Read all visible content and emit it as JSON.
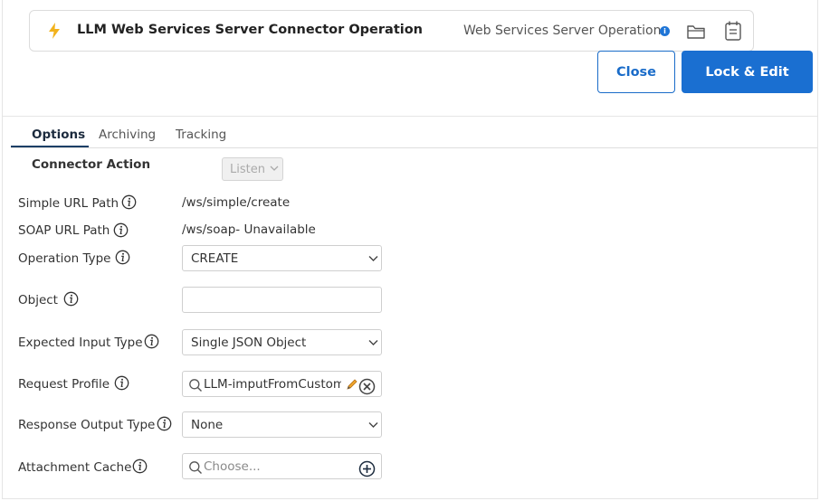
{
  "header": {
    "title": "LLM Web Services Server Connector Operation",
    "subtitle": "Web Services Server Operation",
    "info_glyph": "i",
    "icons": [
      "bolt-icon",
      "info-icon",
      "folder-icon",
      "notes-icon"
    ]
  },
  "actions": {
    "close_label": "Close",
    "lock_edit_label": "Lock & Edit",
    "primary_color": "#1a6fd1"
  },
  "tabs": [
    {
      "label": "Options",
      "active": true
    },
    {
      "label": "Archiving",
      "active": false
    },
    {
      "label": "Tracking",
      "active": false
    }
  ],
  "connector_action": {
    "label": "Connector Action",
    "value": "Listen",
    "disabled": true
  },
  "form": {
    "simple_url_path": {
      "label": "Simple URL Path",
      "value": "/ws/simple/create"
    },
    "soap_url_path": {
      "label": "SOAP URL Path",
      "value": "/ws/soap- Unavailable"
    },
    "operation_type": {
      "label": "Operation Type",
      "value": "CREATE"
    },
    "object": {
      "label": "Object",
      "value": ""
    },
    "expected_input_type": {
      "label": "Expected Input Type",
      "value": "Single JSON Object"
    },
    "request_profile": {
      "label": "Request Profile",
      "value": "LLM-imputFromCustomer"
    },
    "response_output_type": {
      "label": "Response Output Type",
      "value": "None"
    },
    "attachment_cache": {
      "label": "Attachment Cache",
      "value": "",
      "placeholder": "Choose..."
    }
  }
}
